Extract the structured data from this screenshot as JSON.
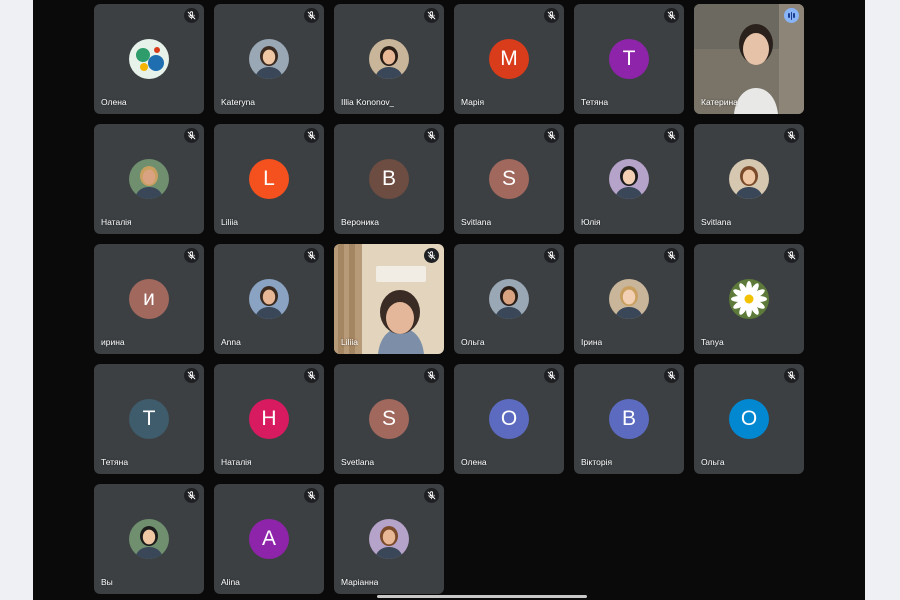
{
  "participants": [
    {
      "name": "Олена",
      "type": "photo",
      "avatar": "sticker-avatar-icon",
      "muted": true
    },
    {
      "name": "Kateryna",
      "type": "photo",
      "avatar": "person-photo-icon",
      "muted": true
    },
    {
      "name": "Illia Kononov_",
      "type": "photo",
      "avatar": "person-photo-icon",
      "muted": true
    },
    {
      "name": "Марія",
      "type": "letter",
      "letter": "M",
      "color": "#d93c1b",
      "muted": true
    },
    {
      "name": "Тетяна",
      "type": "letter",
      "letter": "T",
      "color": "#8e24aa",
      "muted": true
    },
    {
      "name": "Катерина",
      "type": "video",
      "muted": false,
      "speaking": true
    },
    {
      "name": "Наталія",
      "type": "photo",
      "avatar": "person-photo-icon",
      "muted": true
    },
    {
      "name": "Liliia",
      "type": "letter",
      "letter": "L",
      "color": "#f4511e",
      "muted": true
    },
    {
      "name": "Вероника",
      "type": "letter",
      "letter": "B",
      "color": "#6d4c41",
      "muted": true
    },
    {
      "name": "Svitlana",
      "type": "letter",
      "letter": "S",
      "color": "#a1685d",
      "muted": true
    },
    {
      "name": "Юлія",
      "type": "photo",
      "avatar": "person-photo-icon",
      "muted": true
    },
    {
      "name": "Svitlana",
      "type": "photo",
      "avatar": "person-photo-icon",
      "muted": true
    },
    {
      "name": "ирина",
      "type": "letter",
      "letter": "и",
      "color": "#a1685d",
      "muted": true
    },
    {
      "name": "Anna",
      "type": "photo",
      "avatar": "person-photo-icon",
      "muted": true
    },
    {
      "name": "Liliia",
      "type": "video",
      "muted": true
    },
    {
      "name": "Ольга",
      "type": "photo",
      "avatar": "person-photo-icon",
      "muted": true
    },
    {
      "name": "Ірина",
      "type": "photo",
      "avatar": "person-photo-icon",
      "muted": true
    },
    {
      "name": "Tanya",
      "type": "photo",
      "avatar": "flower-icon",
      "muted": true
    },
    {
      "name": "Тетяна",
      "type": "letter",
      "letter": "T",
      "color": "#3e5c6c",
      "muted": true
    },
    {
      "name": "Наталія",
      "type": "letter",
      "letter": "H",
      "color": "#d81b60",
      "muted": true
    },
    {
      "name": "Svetlana",
      "type": "letter",
      "letter": "S",
      "color": "#a1685d",
      "muted": true
    },
    {
      "name": "Олена",
      "type": "letter",
      "letter": "O",
      "color": "#5c6bc0",
      "muted": true
    },
    {
      "name": "Вікторія",
      "type": "letter",
      "letter": "B",
      "color": "#5c6bc0",
      "muted": true
    },
    {
      "name": "Ольга",
      "type": "letter",
      "letter": "O",
      "color": "#0288d1",
      "muted": true
    },
    {
      "name": "Вы",
      "type": "photo",
      "avatar": "person-photo-icon",
      "muted": true
    },
    {
      "name": "Alina",
      "type": "letter",
      "letter": "A",
      "color": "#8e24aa",
      "muted": true
    },
    {
      "name": "Маріанна",
      "type": "photo",
      "avatar": "person-photo-icon",
      "muted": true
    }
  ],
  "colors": {
    "tile_background": "#3c4043",
    "stage_background": "#0a0a0a",
    "speaking_indicator": "#8ab4f8"
  }
}
